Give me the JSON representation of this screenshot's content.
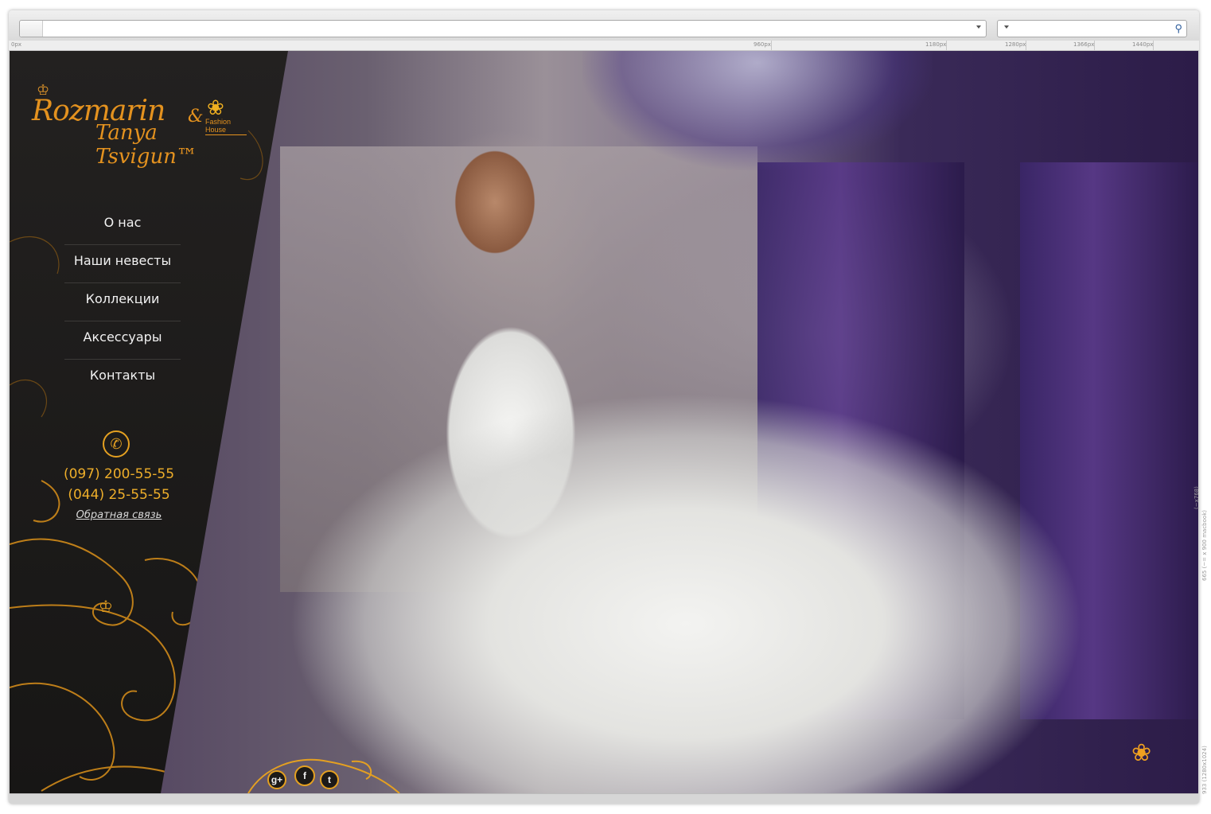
{
  "browser": {
    "address_value": "",
    "search_value": "",
    "ruler_labels": [
      "0px",
      "960px",
      "1180px",
      "1280px",
      "1366px",
      "1440px"
    ],
    "side_ruler_labels": [
      "665 (~= x 900 macbook)",
      "(~x768)",
      "933 (1280x1024)"
    ]
  },
  "site": {
    "logo": {
      "line1": "Rozmarin",
      "ampersand": "&",
      "line2": "Tanya Tsvigun™",
      "tagline": "Fashion House"
    },
    "nav": [
      "О нас",
      "Наши невесты",
      "Коллекции",
      "Аксессуары",
      "Контакты"
    ],
    "contacts": {
      "phone1": "(097) 200-55-55",
      "phone2": "(044) 25-55-55",
      "feedback": "Обратная связь"
    },
    "social": [
      {
        "name": "google-plus",
        "glyph": "g+"
      },
      {
        "name": "facebook",
        "glyph": "f"
      },
      {
        "name": "twitter",
        "glyph": "t"
      }
    ]
  },
  "colors": {
    "accent": "#e4a021",
    "sidebar": "#1e1c1b"
  }
}
